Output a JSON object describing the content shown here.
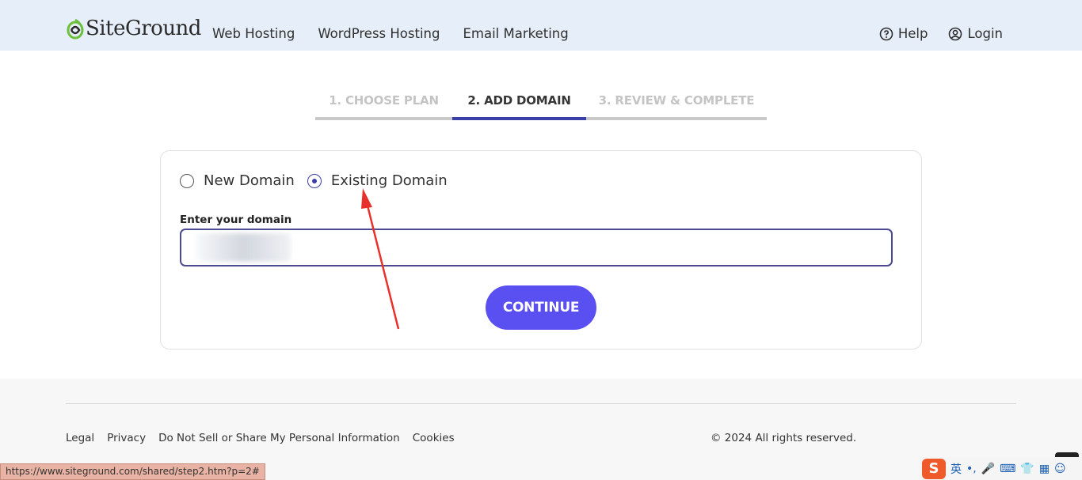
{
  "header": {
    "logo_text": "SiteGround",
    "nav": [
      "Web Hosting",
      "WordPress Hosting",
      "Email Marketing"
    ],
    "help": "Help",
    "login": "Login"
  },
  "steps": [
    {
      "label": "1. CHOOSE PLAN",
      "state": "inactive"
    },
    {
      "label": "2. ADD DOMAIN",
      "state": "active"
    },
    {
      "label": "3. REVIEW & COMPLETE",
      "state": "inactive"
    }
  ],
  "domain_form": {
    "options": [
      {
        "label": "New Domain",
        "checked": false
      },
      {
        "label": "Existing Domain",
        "checked": true
      }
    ],
    "field_label": "Enter your domain",
    "input_value": "",
    "continue_label": "CONTINUE"
  },
  "footer": {
    "links": [
      "Legal",
      "Privacy",
      "Do Not Sell or Share My Personal Information",
      "Cookies"
    ],
    "copyright": "© 2024 All rights reserved."
  },
  "status_bar": {
    "url": "https://www.siteground.com/shared/step2.htm?p=2#"
  },
  "tray": {
    "ime_label": "S",
    "lang": "英"
  },
  "colors": {
    "header_bg": "#e6eff9",
    "accent": "#3b3fa8",
    "button": "#5a4ff0",
    "logo_green": "#6bbf3b",
    "annotation_red": "#e8302a"
  }
}
